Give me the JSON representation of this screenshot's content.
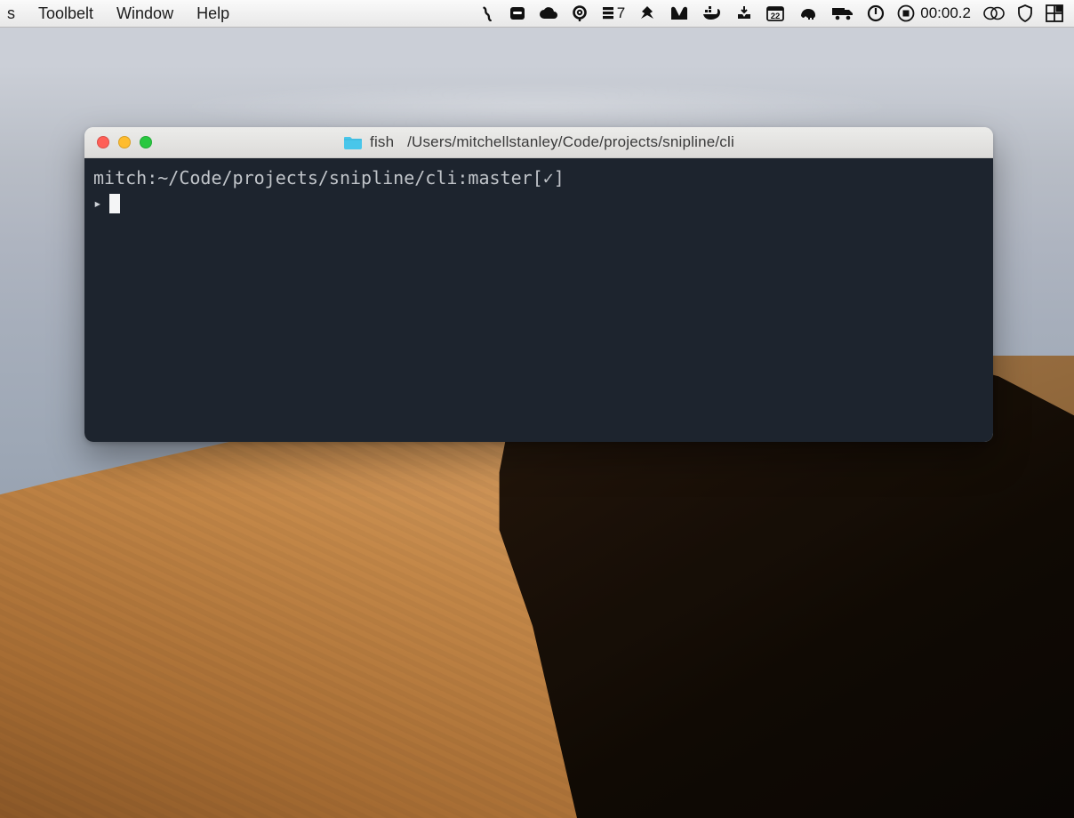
{
  "menubar": {
    "left_items": [
      "s",
      "Toolbelt",
      "Window",
      "Help"
    ],
    "status": {
      "calendar_day": "22",
      "seven_label": "7",
      "timer_text": "00:00.2"
    },
    "icons": [
      "squiggle-icon",
      "card-icon",
      "cloud-icon",
      "headset-icon",
      "stack-icon",
      "antivirus-icon",
      "m-icon",
      "whale-icon",
      "inbox-icon",
      "calendar-icon",
      "elephant-icon",
      "truck-icon",
      "power-icon",
      "stop-record-icon",
      "clipboard-icon",
      "shield-icon",
      "grid-icon"
    ]
  },
  "terminal": {
    "title_shell": "fish",
    "title_path": "/Users/mitchellstanley/Code/projects/snipline/cli",
    "prompt_line": "mitch:~/Code/projects/snipline/cli:master[✓]",
    "prompt_arrow": "▸"
  },
  "colors": {
    "terminal_bg": "#1d242e",
    "terminal_text": "#cfd3d9",
    "folder_icon": "#49c6ea",
    "traffic_red": "#ff5f57",
    "traffic_yellow": "#febc2e",
    "traffic_green": "#28c840"
  }
}
